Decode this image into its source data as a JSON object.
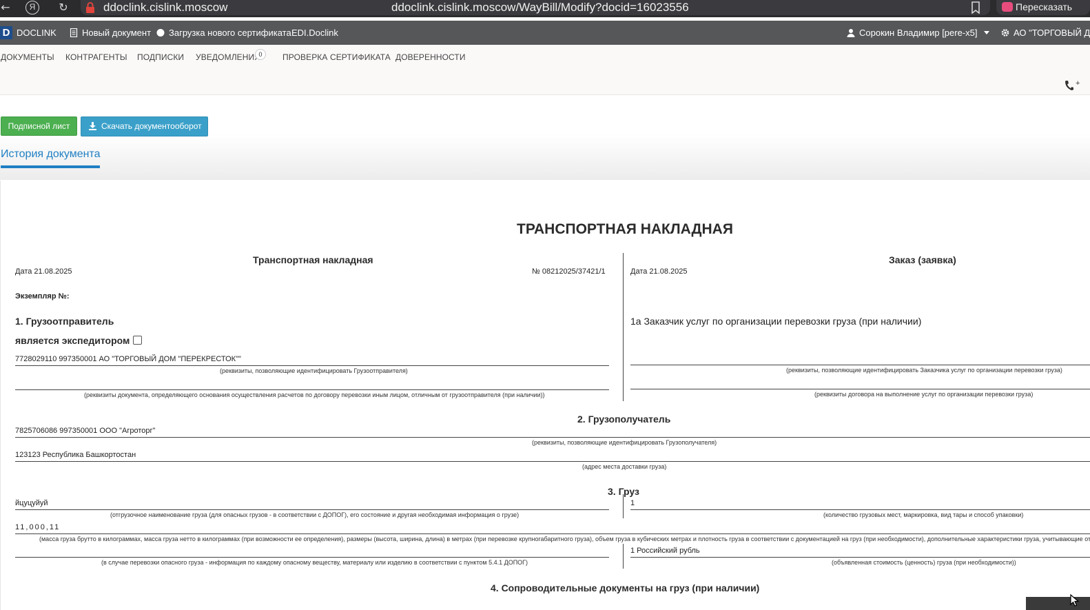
{
  "browser": {
    "domain": "ddoclink.cislink.moscow",
    "url": "ddoclink.cislink.moscow/WayBill/Modify?docid=16023556",
    "yandex_glyph": "Я",
    "retell_label": "Пересказать"
  },
  "app_nav": {
    "brand": "DOCLINK",
    "new_doc": "Новый документ",
    "upload_cert": "Загрузка нового сертификата",
    "edi": "EDI.Doclink",
    "user": "Сорокин Владимир [pere-x5]",
    "org": "АО \"ТОРГОВЫЙ Д"
  },
  "sub_nav": {
    "tabs": [
      "ДОКУМЕНТЫ",
      "КОНТРАГЕНТЫ",
      "ПОДПИСКИ",
      "УВЕДОМЛЕНИЯ",
      "ПРОВЕРКА СЕРТИФИКАТА",
      "ДОВЕРЕННОСТИ"
    ],
    "notifications_count": "0",
    "phone_glyph": "+"
  },
  "toolbar": {
    "sign_sheet": "Подписной лист",
    "download": "Скачать документооборот",
    "history_tab": "История документа"
  },
  "document": {
    "title": "ТРАНСПОРТНАЯ НАКЛАДНАЯ",
    "left_header": "Транспортная накладная",
    "right_header": "Заказ (заявка)",
    "date_left": "Дата  21.08.2025",
    "number": "№   08212025/37421/1",
    "date_right": "Дата 21.08.2025",
    "copy_no": "Экземпляр №:",
    "sec1_title": "1. Грузоотправитель",
    "expeditor_label": "является экспедитором",
    "shipper_value": "7728029110 997350001 АО \"ТОРГОВЫЙ ДОМ \"ПЕРЕКРЕСТОК\"\"",
    "shipper_caption": "(реквизиты, позволяющие идентифицировать Грузоотправителя)",
    "settlement_caption": "(реквизиты документа, определяющего основания осуществления расчетов по договору перевозки иным лицом, отличным от грузоотправителя (при наличии))",
    "sec1a_title": "1а Заказчик услуг по организации перевозки груза (при наличии)",
    "customer_caption": "(реквизиты, позволяющие идентифицировать Заказчика услуг по организации перевозки груза)",
    "contract_caption": "(реквизиты договора на выполнение услуг по организации перевозки груза)",
    "sec2_title": "2. Грузополучатель",
    "consignee_value": "7825706086 997350001 ООО \"Агроторг\"",
    "consignee_caption": "(реквизиты, позволяющие идентифицировать Грузополучателя)",
    "address_value": "123123 Республика Башкортостан",
    "address_caption": "(адрес места доставки груза)",
    "sec3_title": "3. Груз",
    "cargo_name_value": "йцуцуйуй",
    "cargo_name_caption": "(отгрузочное наименование груза (для опасных грузов - в соответствии с ДОПОГ), его состояние и другая необходимая информация о грузе)",
    "places_value": "1",
    "places_caption": "(количество грузовых мест, маркировка, вид тары и способ упаковки)",
    "mass_value": "11,000,11",
    "mass_caption": "(масса груза брутто в килограммах, масса груза нетто в килограммах (при возможности ее определения), размеры (высота, ширина, длина) в метрах (при перевозке крупногабаритного груза), объем груза в кубических метрах и плотность груза в соответствии с документацией на груз (при необходимости), дополнительные характеристики груза, учитывающие от",
    "dangerous_caption": "(в случае перевозки опасного груза - информация по каждому опасному веществу, материалу или изделию в соответствии с пунктом 5.4.1 ДОПОГ)",
    "value_value": "1 Российский рубль",
    "value_caption": "(объявленная стоимость (ценность) груза (при необходимости))",
    "sec4_title": "4. Сопроводительные документы на груз (при наличии)"
  }
}
